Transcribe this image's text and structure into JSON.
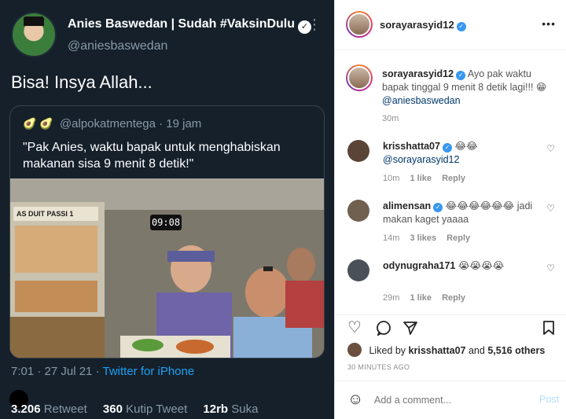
{
  "twitter": {
    "name": "Anies Baswedan | Sudah #VaksinDulu",
    "handle": "@aniesbaswedan",
    "text": "Bisa! Insya Allah...",
    "quote": {
      "emojis": "🥑 🥑",
      "handle": "@alpokatmentega",
      "sep": "·",
      "time": "19 jam",
      "text": "\"Pak Anies, waktu bapak untuk menghabiskan makanan sisa 9 menit 8 detik!\"",
      "timer": "09:08",
      "sign": "AS DUIT PASSI 1"
    },
    "timestamp": "7:01 · 27 Jul 21 ·",
    "source": "Twitter for iPhone",
    "stats": {
      "retweets": "3.206",
      "retweets_label": "Retweet",
      "quotes": "360",
      "quotes_label": "Kutip Tweet",
      "likes": "12rb",
      "likes_label": "Suka"
    }
  },
  "instagram": {
    "username": "sorayarasyid12",
    "caption": {
      "user": "sorayarasyid12",
      "text": "Ayo pak waktu bapak tinggal 9 menit 8 detik lagi!!!",
      "emoji": "😁",
      "mention": "@aniesbaswedan",
      "time": "30m"
    },
    "comments": [
      {
        "user": "krisshatta07",
        "text": "😂😂",
        "mention": "@sorayarasyid12",
        "time": "10m",
        "likes": "1 like",
        "reply": "Reply",
        "verified": true
      },
      {
        "user": "alimensan",
        "text": "😂😂😂😂😂😂 jadi makan kaget yaaaa",
        "mention": "",
        "time": "14m",
        "likes": "3 likes",
        "reply": "Reply",
        "verified": true
      },
      {
        "user": "odynugraha171",
        "text": "😭😭😭😭",
        "mention": "",
        "time": "29m",
        "likes": "1 like",
        "reply": "Reply",
        "verified": false
      }
    ],
    "likes": {
      "prefix": "Liked by",
      "user": "krisshatta07",
      "rest_prefix": "and",
      "rest": "5,516 others"
    },
    "ago": "30 MINUTES AGO",
    "add_comment_placeholder": "Add a comment...",
    "post_label": "Post"
  }
}
